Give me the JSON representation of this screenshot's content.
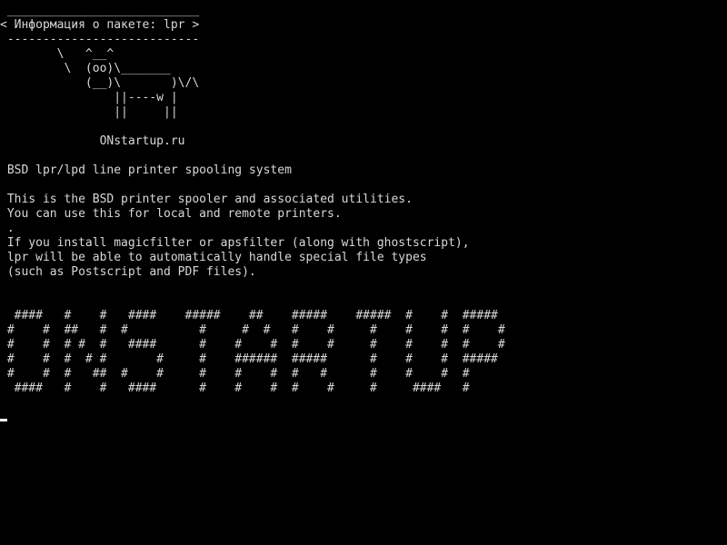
{
  "terminal": {
    "foreground_color": "#d8d8d8",
    "background_color": "#000000",
    "cowsay": {
      "bubble_top": " ___________________________",
      "bubble_text": "< Информация о пакете: lpr >",
      "bubble_bottom": " ---------------------------",
      "cow_lines": [
        "        \\   ^__^",
        "         \\  (oo)\\_______",
        "            (__)\\       )\\/\\",
        "                ||----w |",
        "                ||     ||"
      ]
    },
    "site_line": "              ONstartup.ru",
    "package_description": {
      "summary": " BSD lpr/lpd line printer spooling system",
      "lines": [
        " This is the BSD printer spooler and associated utilities.",
        " You can use this for local and remote printers.",
        " .",
        " If you install magicfilter or apsfilter (along with ghostscript),",
        " lpr will be able to automatically handle special file types",
        " (such as Postscript and PDF files)."
      ]
    },
    "banner_lines": [
      "  ####   #    #   ####    #####    ##    #####    #####  #    #  #####",
      " #    #  ##   #  #          #     #  #   #    #     #    #    #  #    #",
      " #    #  # #  #   ####      #    #    #  #    #     #    #    #  #    #",
      " #    #  #  # #       #     #    ######  #####      #    #    #  #####",
      " #    #  #   ##  #    #     #    #    #  #   #      #    #    #  #",
      "  ####   #    #   ####      #    #    #  #    #     #     ####   #"
    ]
  }
}
